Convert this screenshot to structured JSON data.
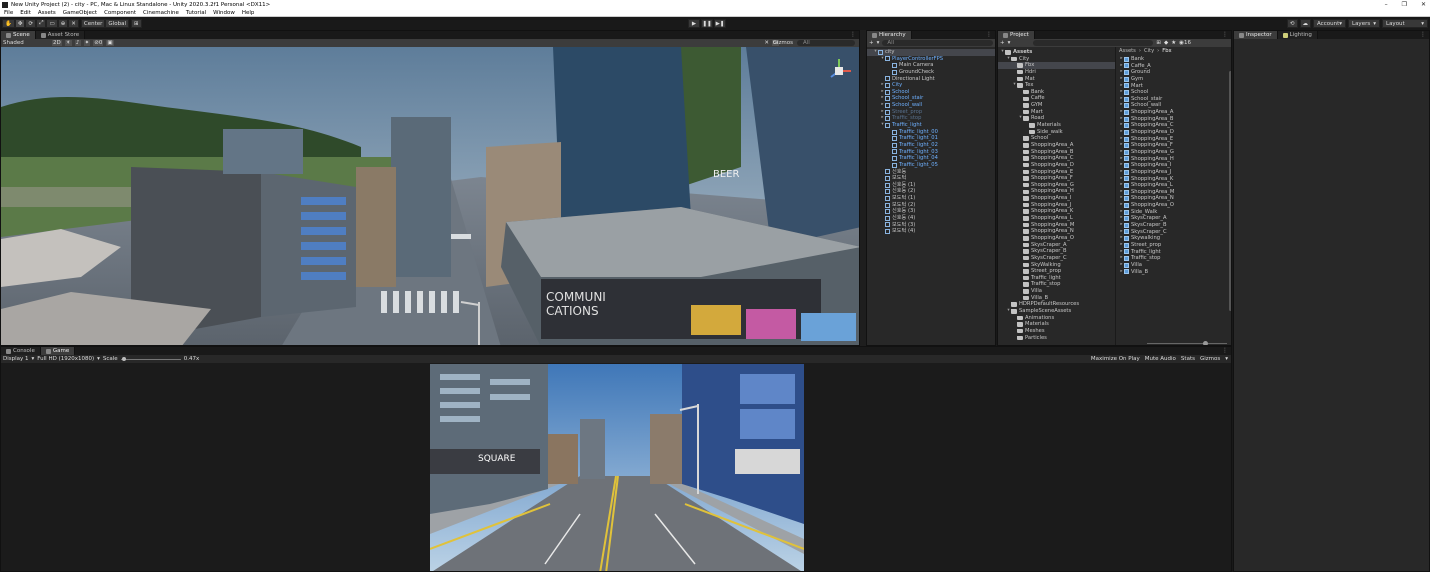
{
  "window": {
    "title": "New Unity Project (2) - city - PC, Mac & Linux Standalone - Unity 2020.3.2f1 Personal <DX11>",
    "controls": [
      "–",
      "❐",
      "✕"
    ]
  },
  "menu": [
    "File",
    "Edit",
    "Assets",
    "GameObject",
    "Component",
    "Cinemachine",
    "Tutorial",
    "Window",
    "Help"
  ],
  "toolbar": {
    "tools": [
      "✋",
      "✥",
      "⟳",
      "⤢",
      "▭",
      "⊕",
      "✕"
    ],
    "pivot_label": "Center",
    "space_label": "Global",
    "snap_label": "⊞",
    "play_controls": [
      "▶",
      "❚❚",
      "▶❚"
    ],
    "collab_icon": "☁",
    "account_label": "Account",
    "layers_label": "Layers",
    "layout_label": "Layout"
  },
  "scene_panel": {
    "tabs": [
      "Scene",
      "Asset Store"
    ],
    "draw_mode": "Shaded",
    "mode_2d": "2D",
    "gizmos_label": "Gizmos",
    "search_placeholder": "All",
    "persp_label": "",
    "hidden_count": "0"
  },
  "hierarchy": {
    "tab": "Hierarchy",
    "add_label": "+",
    "search_placeholder": "All",
    "rows": [
      {
        "label": "city",
        "level": 0,
        "arrow": "▾",
        "style": "sel"
      },
      {
        "label": "PlayerControllerFPS",
        "level": 1,
        "arrow": "▾",
        "style": "blue"
      },
      {
        "label": "Main Camera",
        "level": 2,
        "arrow": "",
        "style": "normal"
      },
      {
        "label": "GroundCheck",
        "level": 2,
        "arrow": "",
        "style": "normal"
      },
      {
        "label": "Directional Light",
        "level": 1,
        "arrow": "",
        "style": "normal"
      },
      {
        "label": "City",
        "level": 1,
        "arrow": "▸",
        "style": "blue"
      },
      {
        "label": "School",
        "level": 1,
        "arrow": "▸",
        "style": "blue"
      },
      {
        "label": "School_stair",
        "level": 1,
        "arrow": "▸",
        "style": "blue"
      },
      {
        "label": "School_wall",
        "level": 1,
        "arrow": "▸",
        "style": "blue"
      },
      {
        "label": "Street_prop",
        "level": 1,
        "arrow": "▸",
        "style": "dim"
      },
      {
        "label": "Traffic_stop",
        "level": 1,
        "arrow": "▸",
        "style": "dim"
      },
      {
        "label": "Traffic_light",
        "level": 1,
        "arrow": "▾",
        "style": "blue"
      },
      {
        "label": "Traffic_light_00",
        "level": 2,
        "arrow": "",
        "style": "blue"
      },
      {
        "label": "Traffic_light_01",
        "level": 2,
        "arrow": "",
        "style": "blue"
      },
      {
        "label": "Traffic_light_02",
        "level": 2,
        "arrow": "",
        "style": "blue"
      },
      {
        "label": "Traffic_light_03",
        "level": 2,
        "arrow": "",
        "style": "blue"
      },
      {
        "label": "Traffic_light_04",
        "level": 2,
        "arrow": "",
        "style": "blue"
      },
      {
        "label": "Traffic_light_05",
        "level": 2,
        "arrow": "",
        "style": "blue"
      },
      {
        "label": "신호등",
        "level": 1,
        "arrow": "",
        "style": "normal"
      },
      {
        "label": "보도턱",
        "level": 1,
        "arrow": "",
        "style": "normal"
      },
      {
        "label": "신호등 (1)",
        "level": 1,
        "arrow": "",
        "style": "normal"
      },
      {
        "label": "신호등 (2)",
        "level": 1,
        "arrow": "",
        "style": "normal"
      },
      {
        "label": "보도턱 (1)",
        "level": 1,
        "arrow": "",
        "style": "normal"
      },
      {
        "label": "보도턱 (2)",
        "level": 1,
        "arrow": "",
        "style": "normal"
      },
      {
        "label": "신호등 (3)",
        "level": 1,
        "arrow": "",
        "style": "normal"
      },
      {
        "label": "신호등 (4)",
        "level": 1,
        "arrow": "",
        "style": "normal"
      },
      {
        "label": "보도턱 (3)",
        "level": 1,
        "arrow": "",
        "style": "normal"
      },
      {
        "label": "보도턱 (4)",
        "level": 1,
        "arrow": "",
        "style": "normal"
      }
    ]
  },
  "project": {
    "tab": "Project",
    "add_label": "+",
    "item_count": "16",
    "breadcrumb": [
      "Assets",
      "City",
      "Fbx"
    ],
    "folder_tree": [
      {
        "label": "Assets",
        "level": 0,
        "arrow": "▾",
        "style": "bold"
      },
      {
        "label": "City",
        "level": 1,
        "arrow": "▾",
        "style": "normal"
      },
      {
        "label": "Fbx",
        "level": 2,
        "arrow": "",
        "style": "sel"
      },
      {
        "label": "Hdri",
        "level": 2,
        "arrow": "",
        "style": "normal"
      },
      {
        "label": "Mat",
        "level": 2,
        "arrow": "",
        "style": "normal"
      },
      {
        "label": "Tex",
        "level": 2,
        "arrow": "▾",
        "style": "normal"
      },
      {
        "label": "Bank",
        "level": 3,
        "arrow": "",
        "style": "normal"
      },
      {
        "label": "Caffe",
        "level": 3,
        "arrow": "",
        "style": "normal"
      },
      {
        "label": "GYM",
        "level": 3,
        "arrow": "",
        "style": "normal"
      },
      {
        "label": "Mart",
        "level": 3,
        "arrow": "",
        "style": "normal"
      },
      {
        "label": "Road",
        "level": 3,
        "arrow": "▾",
        "style": "normal"
      },
      {
        "label": "Materials",
        "level": 4,
        "arrow": "",
        "style": "normal"
      },
      {
        "label": "Side_walk",
        "level": 4,
        "arrow": "",
        "style": "normal"
      },
      {
        "label": "School",
        "level": 3,
        "arrow": "",
        "style": "normal"
      },
      {
        "label": "ShoppingArea_A",
        "level": 3,
        "arrow": "",
        "style": "normal"
      },
      {
        "label": "ShoppingArea_B",
        "level": 3,
        "arrow": "",
        "style": "normal"
      },
      {
        "label": "ShoppingArea_C",
        "level": 3,
        "arrow": "",
        "style": "normal"
      },
      {
        "label": "ShoppingArea_D",
        "level": 3,
        "arrow": "",
        "style": "normal"
      },
      {
        "label": "ShoppingArea_E",
        "level": 3,
        "arrow": "",
        "style": "normal"
      },
      {
        "label": "ShoppingArea_F",
        "level": 3,
        "arrow": "",
        "style": "normal"
      },
      {
        "label": "ShoppingArea_G",
        "level": 3,
        "arrow": "",
        "style": "normal"
      },
      {
        "label": "ShoppingArea_H",
        "level": 3,
        "arrow": "",
        "style": "normal"
      },
      {
        "label": "ShoppingArea_I",
        "level": 3,
        "arrow": "",
        "style": "normal"
      },
      {
        "label": "ShoppingArea_J",
        "level": 3,
        "arrow": "",
        "style": "normal"
      },
      {
        "label": "ShoppingArea_K",
        "level": 3,
        "arrow": "",
        "style": "normal"
      },
      {
        "label": "ShoppingArea_L",
        "level": 3,
        "arrow": "",
        "style": "normal"
      },
      {
        "label": "ShoppingArea_M",
        "level": 3,
        "arrow": "",
        "style": "normal"
      },
      {
        "label": "ShoppingArea_N",
        "level": 3,
        "arrow": "",
        "style": "normal"
      },
      {
        "label": "ShoppingArea_O",
        "level": 3,
        "arrow": "",
        "style": "normal"
      },
      {
        "label": "SkysCraper_A",
        "level": 3,
        "arrow": "",
        "style": "normal"
      },
      {
        "label": "SkysCraper_B",
        "level": 3,
        "arrow": "",
        "style": "normal"
      },
      {
        "label": "SkysCraper_C",
        "level": 3,
        "arrow": "",
        "style": "normal"
      },
      {
        "label": "SkyWalking",
        "level": 3,
        "arrow": "",
        "style": "normal"
      },
      {
        "label": "Street_prop",
        "level": 3,
        "arrow": "",
        "style": "normal"
      },
      {
        "label": "Traffic_light",
        "level": 3,
        "arrow": "",
        "style": "normal"
      },
      {
        "label": "Traffic_stop",
        "level": 3,
        "arrow": "",
        "style": "normal"
      },
      {
        "label": "Villa",
        "level": 3,
        "arrow": "",
        "style": "normal"
      },
      {
        "label": "Villa_B",
        "level": 3,
        "arrow": "",
        "style": "normal"
      },
      {
        "label": "HDRPDefaultResources",
        "level": 1,
        "arrow": "",
        "style": "normal"
      },
      {
        "label": "SampleSceneAssets",
        "level": 1,
        "arrow": "▾",
        "style": "normal"
      },
      {
        "label": "Animations",
        "level": 2,
        "arrow": "",
        "style": "normal"
      },
      {
        "label": "Materials",
        "level": 2,
        "arrow": "",
        "style": "normal"
      },
      {
        "label": "Meshes",
        "level": 2,
        "arrow": "",
        "style": "normal"
      },
      {
        "label": "Particles",
        "level": 2,
        "arrow": "",
        "style": "normal"
      }
    ],
    "assets": [
      "Bank",
      "Caffe_A",
      "Ground",
      "Gym",
      "Mart",
      "School",
      "School_stair",
      "School_wall",
      "ShoppingArea_A",
      "ShoppingArea_B",
      "ShoppingArea_C",
      "ShoppingArea_D",
      "ShoppingArea_E",
      "ShoppingArea_F",
      "ShoppingArea_G",
      "ShoppingArea_H",
      "ShoppingArea_I",
      "ShoppingArea_J",
      "ShoppingArea_K",
      "ShoppingArea_L",
      "ShoppingArea_M",
      "ShoppingArea_N",
      "ShoppingArea_O",
      "Side_Walk",
      "SkysCraper_A",
      "SkysCraper_B",
      "SkysCraper_C",
      "Skywalking",
      "Street_prop",
      "Traffic_light",
      "Traffic_stop",
      "Villa",
      "Villa_B"
    ]
  },
  "inspector": {
    "tabs": [
      "Inspector",
      "Lighting"
    ]
  },
  "game_panel": {
    "tabs": [
      "Console",
      "Game"
    ],
    "display": "Display 1",
    "resolution": "Full HD (1920x1080)",
    "scale_label": "Scale",
    "scale_value": "0.47x",
    "scale_fraction": 0.02,
    "options": [
      "Maximize On Play",
      "Mute Audio",
      "Stats",
      "Gizmos"
    ]
  },
  "scene_signs": {
    "sign_1": "COMMUNI",
    "sign_2": "CATIONS",
    "sign_3": "BEER",
    "game_sign": "SQUARE"
  },
  "colors": {
    "editor_bg": "#191919",
    "panel_bg": "#282828",
    "highlight_text": "#6fb1ff"
  }
}
